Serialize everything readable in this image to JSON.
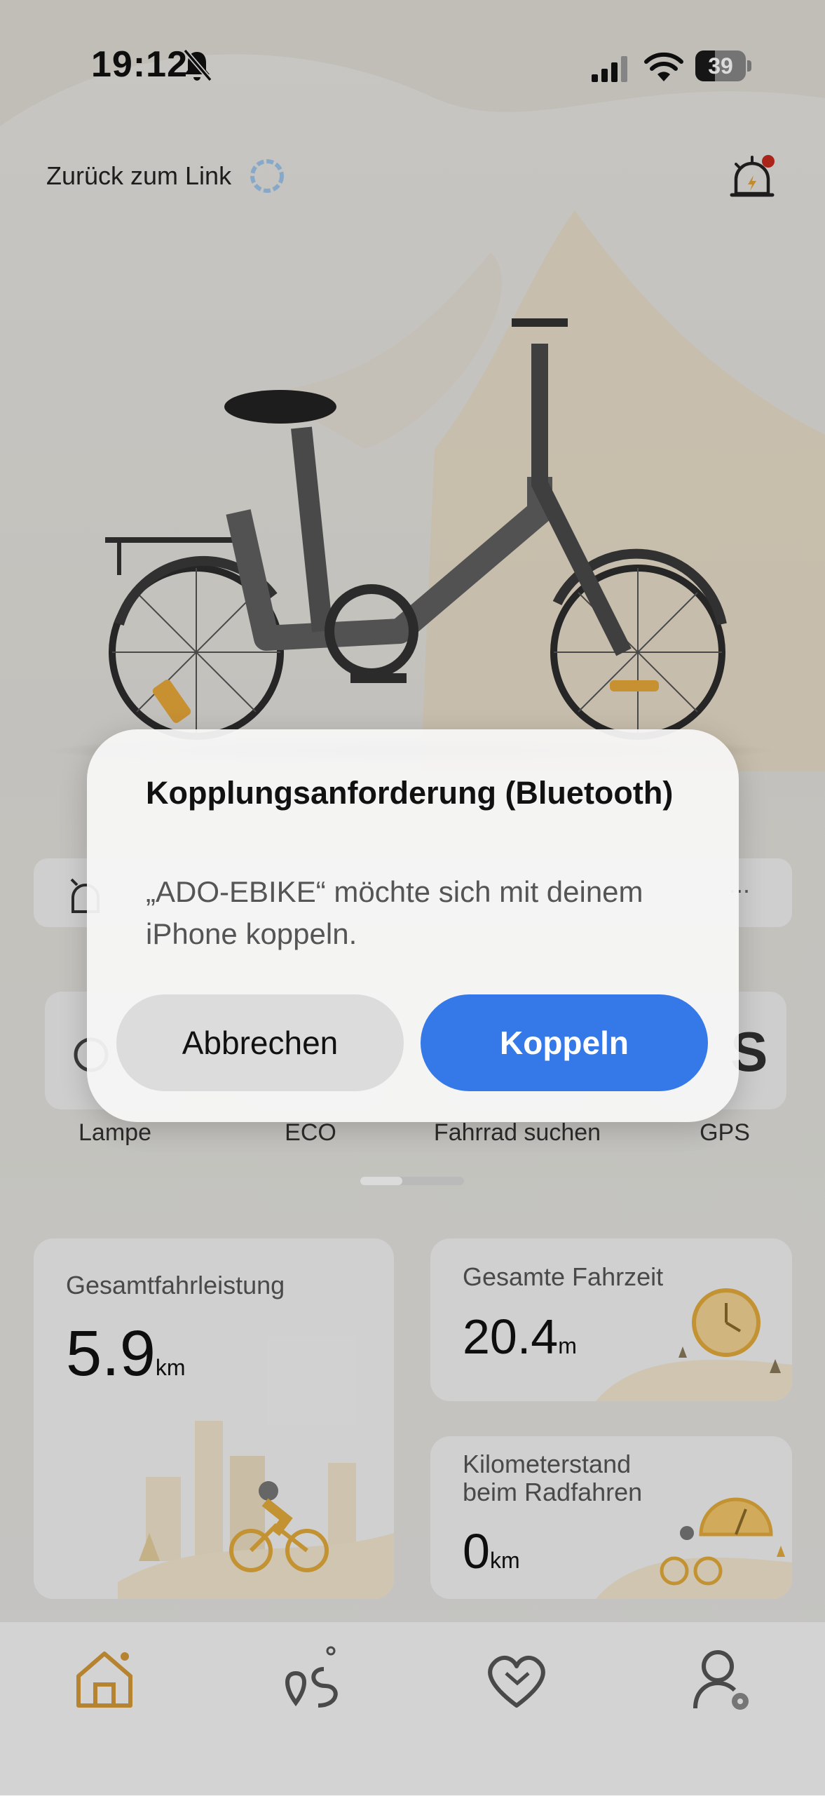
{
  "status_bar": {
    "time": "19:12",
    "battery_level": "39"
  },
  "header": {
    "back_link": "Zurück zum Link"
  },
  "quick_actions": [
    {
      "label": "Lampe"
    },
    {
      "label": "ECO"
    },
    {
      "label": "Fahrrad suchen"
    },
    {
      "label": "GPS"
    }
  ],
  "stats": {
    "total_distance": {
      "title": "Gesamtfahrleistung",
      "value": "5.9",
      "unit": "km"
    },
    "total_time": {
      "title": "Gesamte Fahrzeit",
      "value": "20.4",
      "unit": "m"
    },
    "odometer": {
      "title": "Kilometerstand beim Radfahren",
      "value": "0",
      "unit": "km"
    }
  },
  "tabbar": {
    "items": [
      "home-icon",
      "route-icon",
      "heart-hands-icon",
      "profile-settings-icon"
    ],
    "accent_color": "#d49a3a"
  },
  "dialog": {
    "title": "Kopplungsanforderung (Bluetooth)",
    "message": "„ADO-EBIKE“ möchte sich mit deinem iPhone koppeln.",
    "cancel_label": "Abbrechen",
    "confirm_label": "Koppeln",
    "confirm_color": "#3579e8"
  }
}
